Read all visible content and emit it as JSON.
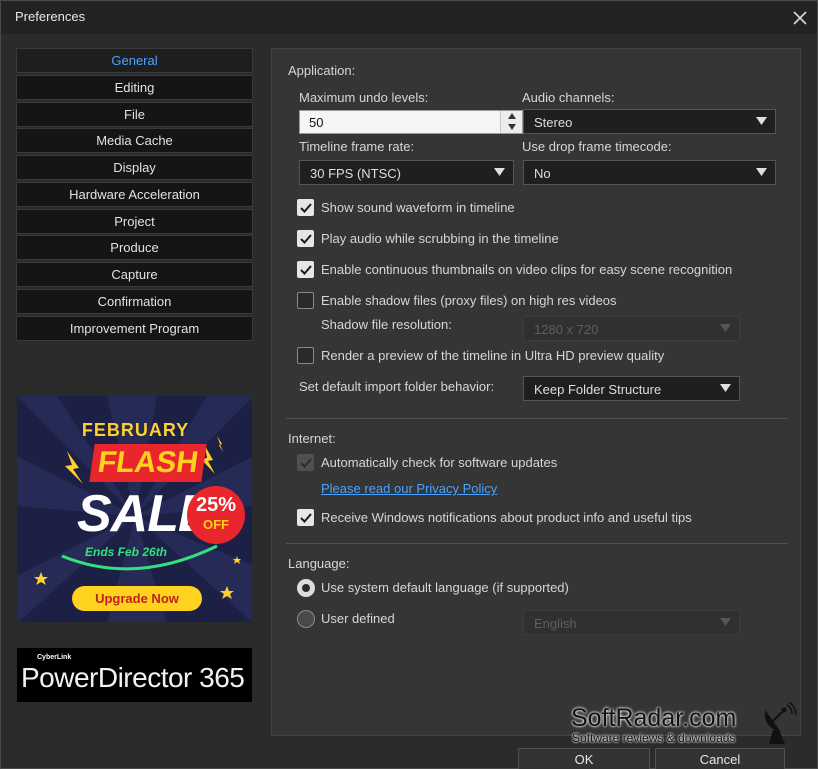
{
  "window": {
    "title": "Preferences"
  },
  "nav": {
    "items": [
      {
        "label": "General",
        "active": true
      },
      {
        "label": "Editing"
      },
      {
        "label": "File"
      },
      {
        "label": "Media Cache"
      },
      {
        "label": "Display"
      },
      {
        "label": "Hardware Acceleration"
      },
      {
        "label": "Project"
      },
      {
        "label": "Produce"
      },
      {
        "label": "Capture"
      },
      {
        "label": "Confirmation"
      },
      {
        "label": "Improvement Program"
      }
    ]
  },
  "ad": {
    "month": "FEBRUARY",
    "flash": "FLASH",
    "sale": "SALE",
    "percent": "25%",
    "off": "OFF",
    "ends": "Ends Feb 26th",
    "button": "Upgrade Now"
  },
  "logo": {
    "brand": "CyberLink",
    "product": "PowerDirector 365"
  },
  "application": {
    "title": "Application:",
    "undo_label": "Maximum undo levels:",
    "undo_value": "50",
    "audio_label": "Audio channels:",
    "audio_value": "Stereo",
    "framerate_label": "Timeline frame rate:",
    "framerate_value": "30 FPS (NTSC)",
    "dropframe_label": "Use drop frame timecode:",
    "dropframe_value": "No",
    "checks": [
      {
        "label": "Show sound waveform in timeline",
        "checked": true
      },
      {
        "label": "Play audio while scrubbing in the timeline",
        "checked": true
      },
      {
        "label": "Enable continuous thumbnails on video clips for easy scene recognition",
        "checked": true
      },
      {
        "label": "Enable shadow files (proxy files) on high res videos",
        "checked": false
      }
    ],
    "shadow_res_label": "Shadow file resolution:",
    "shadow_res_value": "1280 x 720",
    "uhd_label": "Render a preview of the timeline in Ultra HD preview quality",
    "uhd_checked": false,
    "import_label": "Set default import folder behavior:",
    "import_value": "Keep Folder Structure"
  },
  "internet": {
    "title": "Internet:",
    "auto_check_label": "Automatically check for software updates",
    "privacy_link": "Please read our Privacy Policy",
    "notify_label": "Receive Windows notifications about product info and useful tips"
  },
  "language": {
    "title": "Language:",
    "system_label": "Use system default language (if supported)",
    "user_label": "User defined",
    "user_value": "English"
  },
  "buttons": {
    "ok": "OK",
    "cancel": "Cancel"
  },
  "watermark": {
    "main": "SoftRadar.com",
    "sub": "Software reviews & downloads"
  },
  "colors": {
    "accent": "#4da3ff",
    "link": "#4aa3ff",
    "panel": "#353535",
    "window": "#2b2b2b"
  }
}
